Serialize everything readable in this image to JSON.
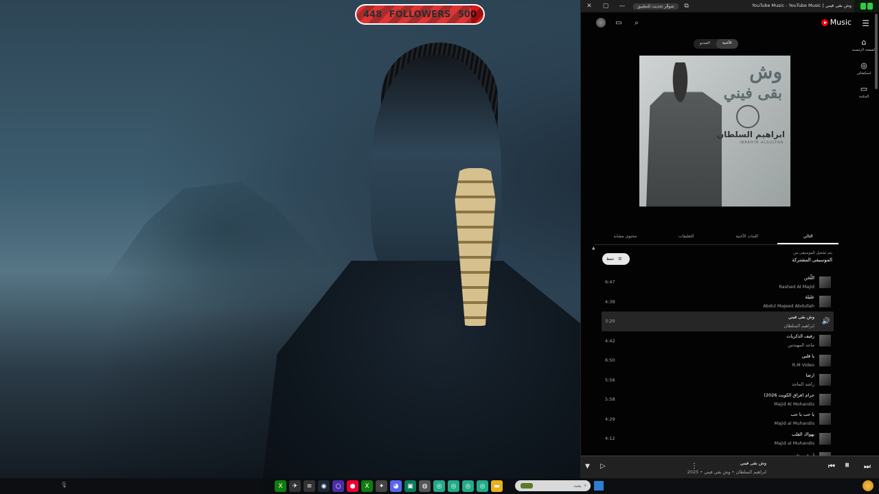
{
  "overlay": {
    "followers_current": "448",
    "followers_label": "FOLLOWERS",
    "followers_goal": "500",
    "progress_fraction": 0.9
  },
  "window": {
    "title": "YouTube Music - YouTube Music | وش بقى فيني",
    "update_button": "شوقّر تحديث للتطبيق",
    "close": "✕",
    "minimize": "—",
    "maximize": "▢"
  },
  "app": {
    "logo_text": "Music",
    "toggle": [
      "الأغنية",
      "الفيديو"
    ],
    "rail": [
      {
        "icon": "⌂",
        "label": "الصفحة الرئيسية"
      },
      {
        "icon": "◎",
        "label": "استكشاف"
      },
      {
        "icon": "▭",
        "label": "المكتبة"
      }
    ]
  },
  "cover": {
    "title_line1": "وش",
    "title_line2": "بقى فيني",
    "artist_ar": "ابراهيم السلطان",
    "artist_en": "IBRAHIM ALSULTAN"
  },
  "tabs": [
    "التالي",
    "كلمات الأغنية",
    "التعليقات",
    "محتوى مشابه"
  ],
  "queue_header": {
    "line1": "يتم تشغيل الموسيقى من",
    "line2": "الموسيقى المشتركة",
    "save_label": "حفظ"
  },
  "queue": [
    {
      "title": "اللّحَن",
      "artist": "Rashed Al Majid",
      "duration": "6:47"
    },
    {
      "title": "عليلة",
      "artist": "Abdul Majeed Abdullah",
      "duration": "4:39"
    },
    {
      "title": "وش بقى فيني",
      "artist": "ابراهيم السلطان",
      "duration": "3:20",
      "playing": true
    },
    {
      "title": "رفيف الذكريات",
      "artist": "ماجد المهندس",
      "duration": "4:42"
    },
    {
      "title": "يا قلبي",
      "artist": "R.M Video",
      "duration": "6:50"
    },
    {
      "title": "ارضا",
      "artist": "راشد الماجد",
      "duration": "5:56"
    },
    {
      "title": "حرام (فراق الكويت 2026)",
      "artist": "Majid Al Mohandis",
      "duration": "5:58"
    },
    {
      "title": "يا حب يا حب",
      "artist": "Majid al Muhandis",
      "duration": "4:29"
    },
    {
      "title": "يهواك القلب",
      "artist": "Majid al Muhandis",
      "duration": "4:12"
    },
    {
      "title": "أبتعادي قلبي",
      "artist": "",
      "duration": ""
    }
  ],
  "player": {
    "title": "وش بقى فيني",
    "subtitle": "ابراهيم السلطان • وش بقى فيني • 2025",
    "progress_fraction": 0.0
  },
  "taskbar": {
    "search_placeholder": "بحث"
  },
  "colors": {
    "accent": "#ff0000",
    "background": "#030303",
    "playing_row": "#262626"
  }
}
